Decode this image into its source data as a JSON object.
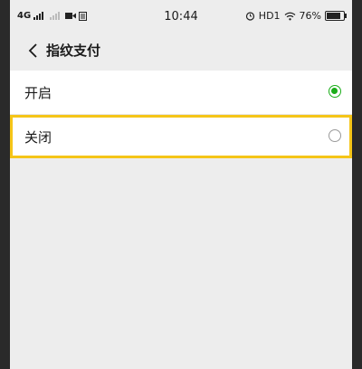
{
  "status_bar": {
    "carrier": "4G",
    "time": "10:44",
    "hd_label": "HD1",
    "battery_percent": "76%"
  },
  "header": {
    "title": "指纹支付"
  },
  "options": [
    {
      "label": "开启",
      "selected": true
    },
    {
      "label": "关闭",
      "selected": false
    }
  ],
  "colors": {
    "accent": "#1aad19",
    "highlight_border": "#f5c518",
    "background": "#ededed"
  }
}
